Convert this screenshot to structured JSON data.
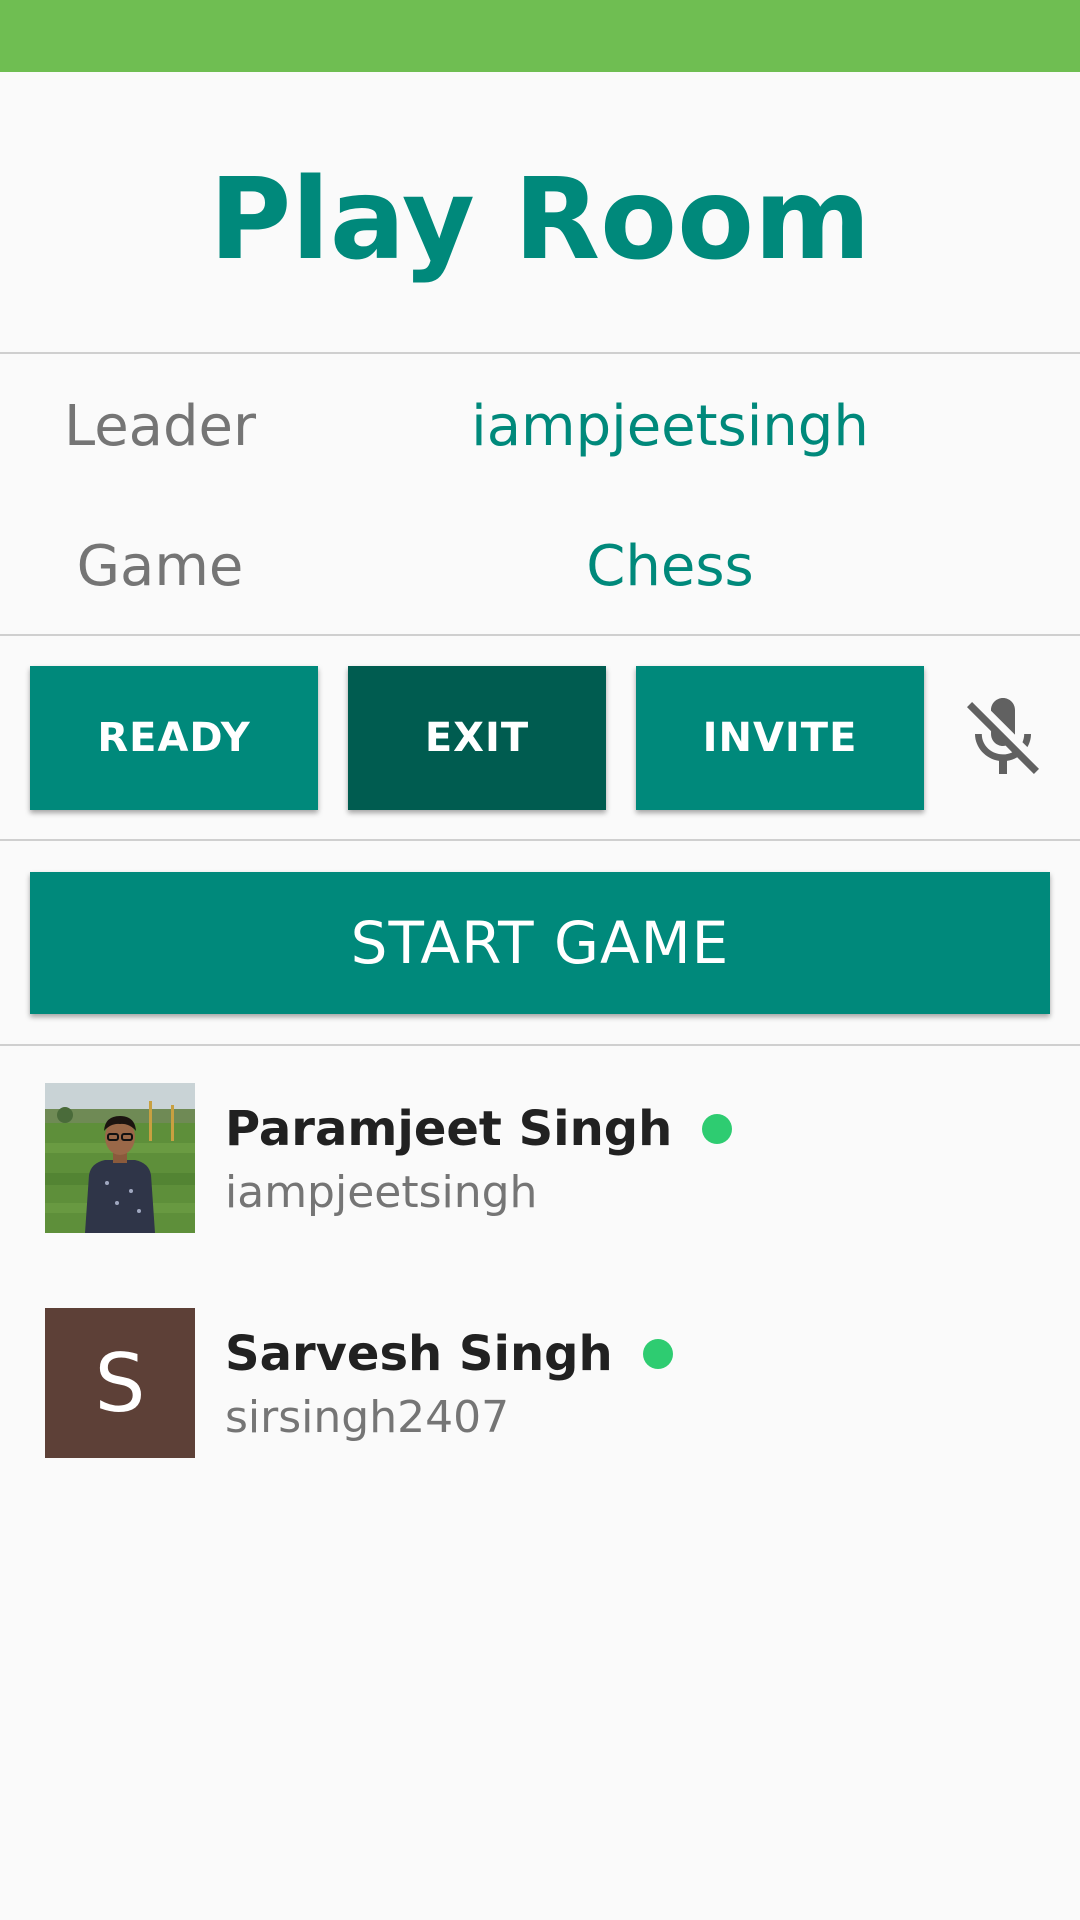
{
  "header": {
    "title": "Play Room"
  },
  "room_info": {
    "leader_label": "Leader",
    "leader_value": "iampjeetsingh",
    "game_label": "Game",
    "game_value": "Chess"
  },
  "actions": {
    "ready_label": "READY",
    "exit_label": "EXIT",
    "invite_label": "INVITE",
    "mic_icon": "mic-off-icon",
    "start_label": "START GAME"
  },
  "players": [
    {
      "name": "Paramjeet Singh",
      "username": "iampjeetsingh",
      "avatar": "photo",
      "online": true
    },
    {
      "name": "Sarvesh Singh",
      "username": "sirsingh2407",
      "avatar_letter": "S",
      "online": true
    }
  ],
  "colors": {
    "status_bar": "#6fbe52",
    "accent": "#00897b",
    "accent_dark": "#005c50",
    "online": "#2ecc71",
    "avatar_bg": "#5d4037"
  }
}
